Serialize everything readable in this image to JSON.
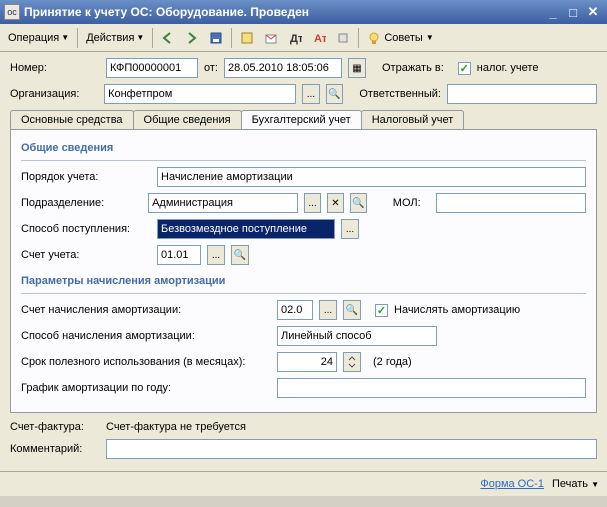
{
  "titlebar": {
    "title": "Принятие к учету ОС: Оборудование. Проведен"
  },
  "toolbar": {
    "operation": "Операция",
    "actions": "Действия",
    "sovety": "Советы"
  },
  "header": {
    "number_label": "Номер:",
    "number_value": "КФП00000001",
    "ot_label": "от:",
    "date_value": "28.05.2010 18:05:06",
    "reflect_label": "Отражать в:",
    "nalog_label": "налог. учете",
    "org_label": "Организация:",
    "org_value": "Конфетпром",
    "resp_label": "Ответственный:",
    "resp_value": ""
  },
  "tabs": {
    "t1": "Основные средства",
    "t2": "Общие сведения",
    "t3": "Бухгалтерский учет",
    "t4": "Налоговый учет"
  },
  "section1": {
    "title": "Общие сведения",
    "poryadok_label": "Порядок учета:",
    "poryadok_value": "Начисление амортизации",
    "podrazd_label": "Подразделение:",
    "podrazd_value": "Администрация",
    "mol_label": "МОЛ:",
    "mol_value": "",
    "sposob_label": "Способ поступления:",
    "sposob_value": "Безвозмездное поступление",
    "schet_label": "Счет учета:",
    "schet_value": "01.01"
  },
  "section2": {
    "title": "Параметры начисления амортизации",
    "schet_nach_label": "Счет начисления амортизации:",
    "schet_nach_value": "02.0",
    "nachislyat_label": "Начислять амортизацию",
    "sposob_nach_label": "Способ начисления амортизации:",
    "sposob_nach_value": "Линейный способ",
    "srok_label": "Срок полезного использования (в месяцах):",
    "srok_value": "24",
    "srok_hint": "(2 года)",
    "grafik_label": "График амортизации по году:",
    "grafik_value": ""
  },
  "bottom": {
    "sf_label": "Счет-фактура:",
    "sf_value": "Счет-фактура не требуется",
    "comment_label": "Комментарий:",
    "comment_value": ""
  },
  "footer": {
    "forma": "Форма ОС-1",
    "print": "Печать"
  }
}
